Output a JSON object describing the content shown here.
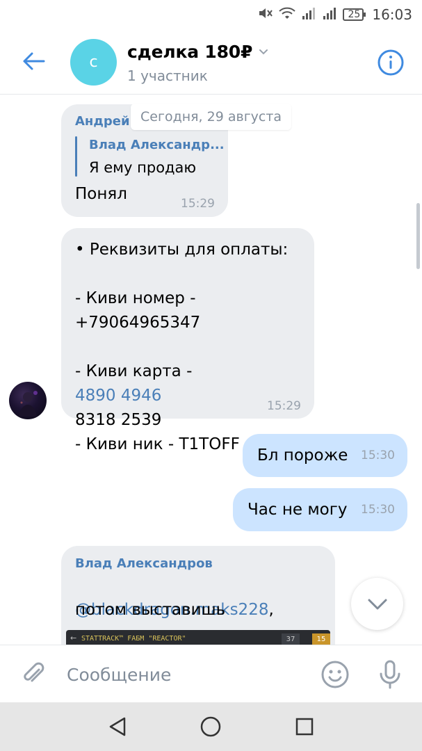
{
  "status_bar": {
    "battery": "25",
    "time": "16:03"
  },
  "header": {
    "avatar_letter": "с",
    "title": "сделка 180₽",
    "subtitle": "1 участник"
  },
  "date_divider": "Сегодня, 29 августа",
  "messages": [
    {
      "sender": "Андрей Т",
      "reply_author": "Влад Александр...",
      "reply_text": "Я ему продаю",
      "text": "Понял",
      "time": "15:29"
    },
    {
      "line1": "• Реквизиты для оплаты:",
      "line2": "- Киви номер -",
      "phone": "+79064965347",
      "card_prefix": "- Киви карта -",
      "card_part1": "4890 4946",
      "card_part2": "8318 2539",
      "nick": "- Киви ник - T1TOFF",
      "time": "15:29"
    },
    {
      "text": "Бл пороже",
      "time": "15:30"
    },
    {
      "text": "Час не могу",
      "time": "15:30"
    },
    {
      "sender": "Влад Александров",
      "mention": "@blackdragon.maks228",
      "comma": ",",
      "text": "потом выставишь",
      "preview_text": "STATTRACK™ FAБМ \"REACTOR\"",
      "preview_badge1": "37",
      "preview_badge2": "15"
    }
  ],
  "composer": {
    "placeholder": "Сообщение"
  },
  "colors": {
    "accent": "#4a7fb8",
    "incoming_bubble": "#ebedf0",
    "outgoing_bubble": "#cce4ff",
    "avatar_bg": "#5ad3e6"
  }
}
